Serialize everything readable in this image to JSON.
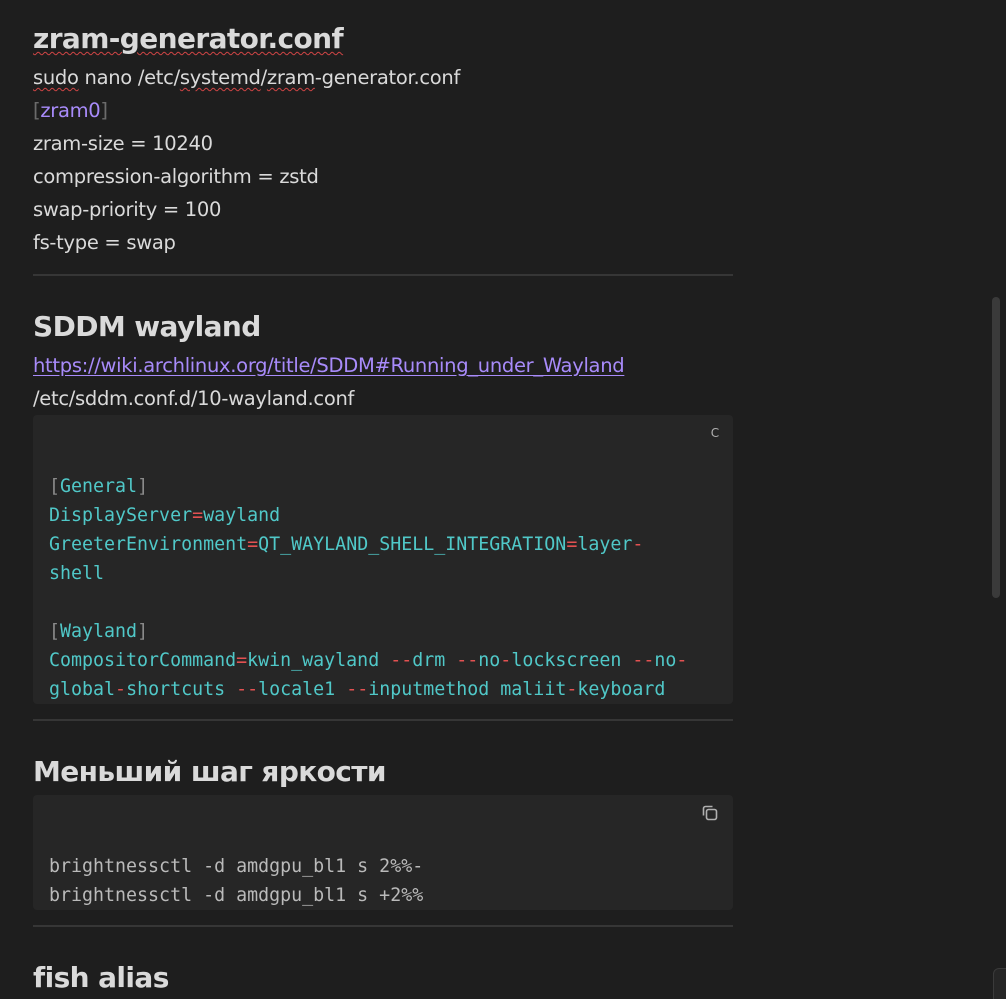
{
  "sections": {
    "zram": {
      "title": "zram-generator.conf",
      "command": {
        "sudo": "sudo",
        "nano": " nano  /etc/",
        "systemd": "systemd",
        "slash": "/",
        "zram": "zram",
        "rest": "-generator.conf"
      },
      "section_name": "zram0",
      "bracket_open": "[",
      "bracket_close": "]",
      "lines": [
        "zram-size = 10240",
        "compression-algorithm = zstd",
        "swap-priority = 100",
        "fs-type = swap"
      ]
    },
    "sddm": {
      "title": "SDDM wayland",
      "link": "https://wiki.archlinux.org/title/SDDM#Running_under_Wayland",
      "path": "/etc/sddm.conf.d/10-wayland.conf",
      "copy_label": "C",
      "code": {
        "general": "General",
        "display_key": "DisplayServer",
        "display_val": "wayland",
        "greeter_key": "GreeterEnvironment",
        "greeter_val1": "QT_WAYLAND_SHELL_INTEGRATION",
        "greeter_val2": "layer",
        "greeter_val3": "shell",
        "wayland": "Wayland",
        "comp_key": "CompositorCommand",
        "comp_1": "kwin_wayland ",
        "comp_2": "drm ",
        "comp_3": "no",
        "comp_4": "lockscreen ",
        "comp_5": "no",
        "comp_6": "global",
        "comp_7": "shortcuts ",
        "comp_8": "locale1 ",
        "comp_9": "inputmethod maliit",
        "comp_10": "keyboard"
      }
    },
    "brightness": {
      "title": "Меньший шаг яркости",
      "lines": [
        "brightnessctl -d amdgpu_bl1 s 2%%-",
        "brightnessctl -d amdgpu_bl1 s +2%%"
      ]
    },
    "fish": {
      "title": "fish alias"
    }
  },
  "icons": {
    "copy": "copy-icon"
  },
  "colors": {
    "background": "#1e1e1e",
    "accent": "#a88bfa",
    "code_key": "#50c8c8",
    "code_operator": "#e35151"
  }
}
